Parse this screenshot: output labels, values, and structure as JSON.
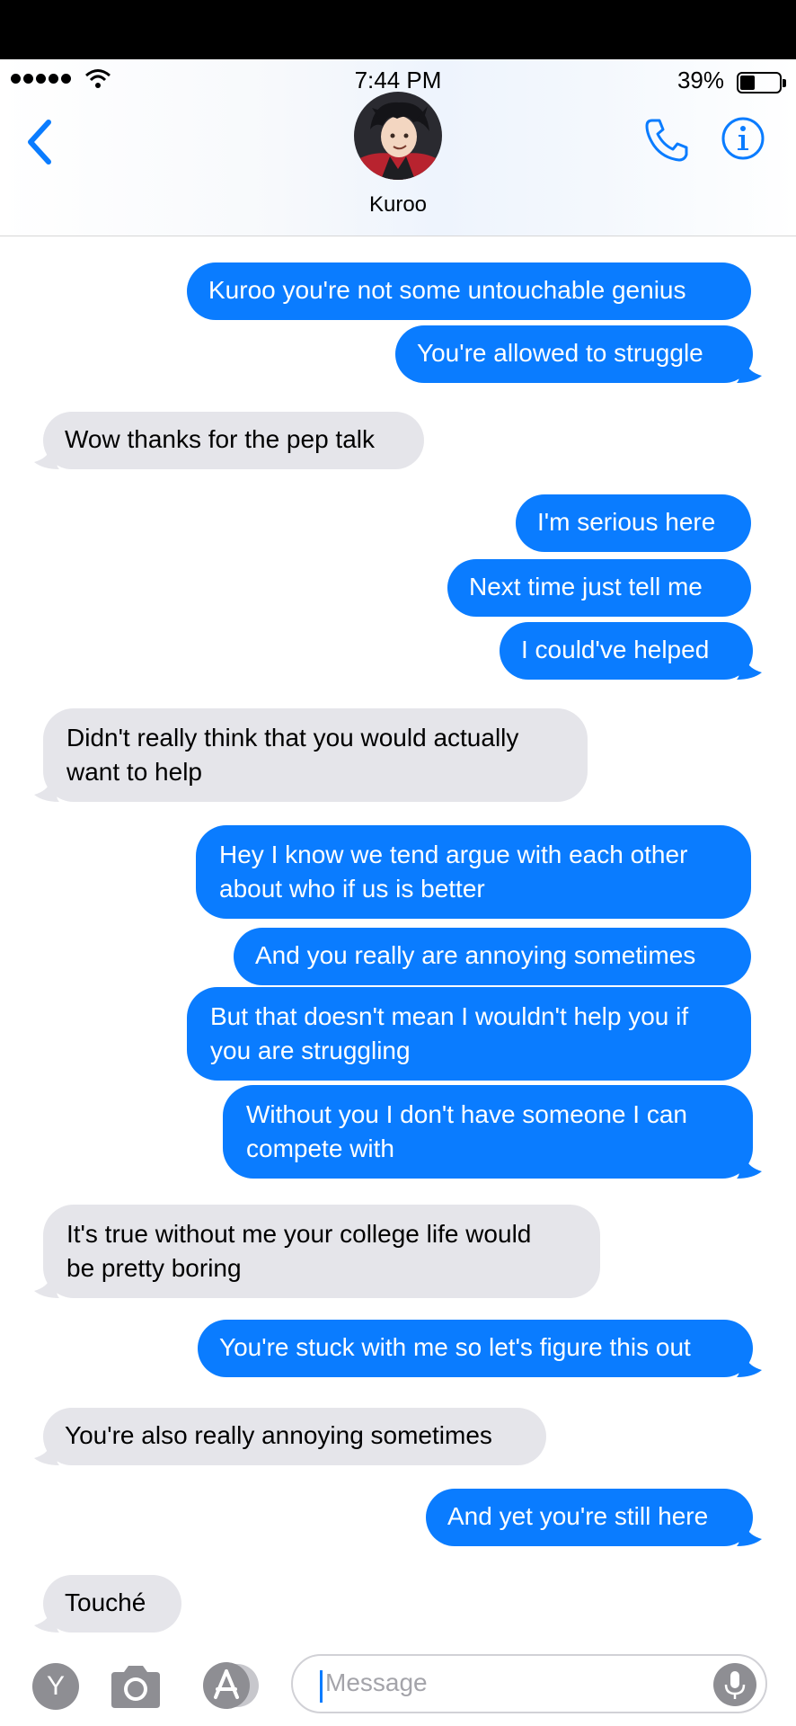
{
  "status_bar": {
    "time": "7:44 PM",
    "battery_percent": "39%",
    "battery_level": 0.39,
    "icons": [
      "signal-dots-icon",
      "wifi-icon",
      "battery-icon"
    ]
  },
  "header": {
    "contact_name": "Kuroo",
    "icons": [
      "back-chevron-icon",
      "phone-icon",
      "info-icon"
    ],
    "accent_color": "#0a7cff"
  },
  "messages": [
    {
      "from": "me",
      "lines": [
        "Kuroo you're not some untouchable genius"
      ]
    },
    {
      "from": "me",
      "lines": [
        "You're allowed to struggle"
      ]
    },
    {
      "from": "them",
      "lines": [
        "Wow thanks for the pep talk"
      ]
    },
    {
      "from": "me",
      "lines": [
        "I'm serious here"
      ]
    },
    {
      "from": "me",
      "lines": [
        "Next time just tell me"
      ]
    },
    {
      "from": "me",
      "lines": [
        "I could've helped"
      ]
    },
    {
      "from": "them",
      "lines": [
        "Didn't really think that you would actually",
        "want to help"
      ]
    },
    {
      "from": "me",
      "lines": [
        "Hey I know we tend argue with each other",
        "about who if us is better"
      ]
    },
    {
      "from": "me",
      "lines": [
        "And you really are annoying sometimes"
      ]
    },
    {
      "from": "me",
      "lines": [
        "But that doesn't mean I wouldn't help you if",
        "you are struggling"
      ]
    },
    {
      "from": "me",
      "lines": [
        "Without you I don't have someone I can",
        "compete with"
      ]
    },
    {
      "from": "them",
      "lines": [
        "It's true without me your college life would",
        "be pretty boring"
      ]
    },
    {
      "from": "me",
      "lines": [
        "You're stuck with me so let's figure this out"
      ]
    },
    {
      "from": "them",
      "lines": [
        "You're also really annoying sometimes"
      ]
    },
    {
      "from": "me",
      "lines": [
        "And yet you're still here"
      ]
    },
    {
      "from": "them",
      "lines": [
        "Touché"
      ]
    }
  ],
  "composer": {
    "y_label": "Y",
    "placeholder": "Message",
    "icons": [
      "camera-icon",
      "app-store-icon",
      "microphone-icon"
    ]
  },
  "colors": {
    "sent_bubble": "#0a7cff",
    "received_bubble": "#e5e5ea"
  }
}
